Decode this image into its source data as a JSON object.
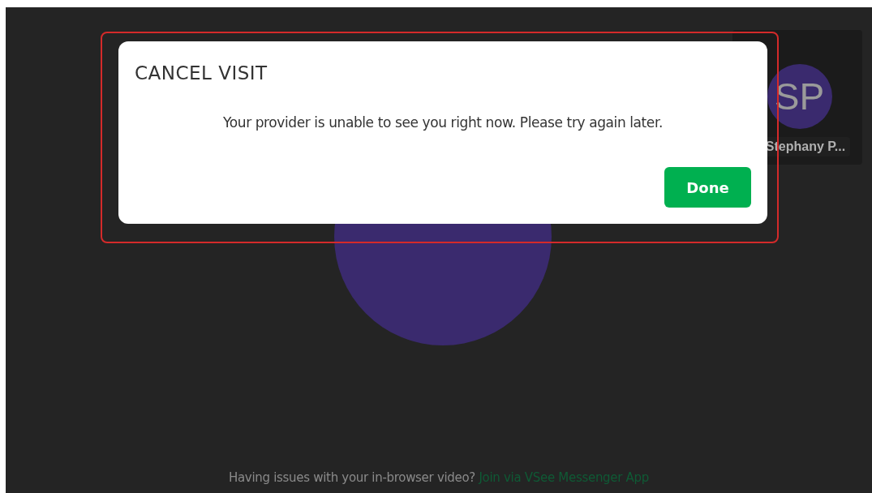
{
  "self_tile": {
    "initials": "SP",
    "name": "Stephany P..."
  },
  "dialog": {
    "title": "CANCEL VISIT",
    "message": "Your provider is unable to see you right now. Please try again later.",
    "buttons": [
      {
        "label": "Done",
        "kind": "primary"
      }
    ]
  },
  "footer": {
    "text": "Having issues with your in-browser video?",
    "link": "Join via VSee Messenger App"
  }
}
